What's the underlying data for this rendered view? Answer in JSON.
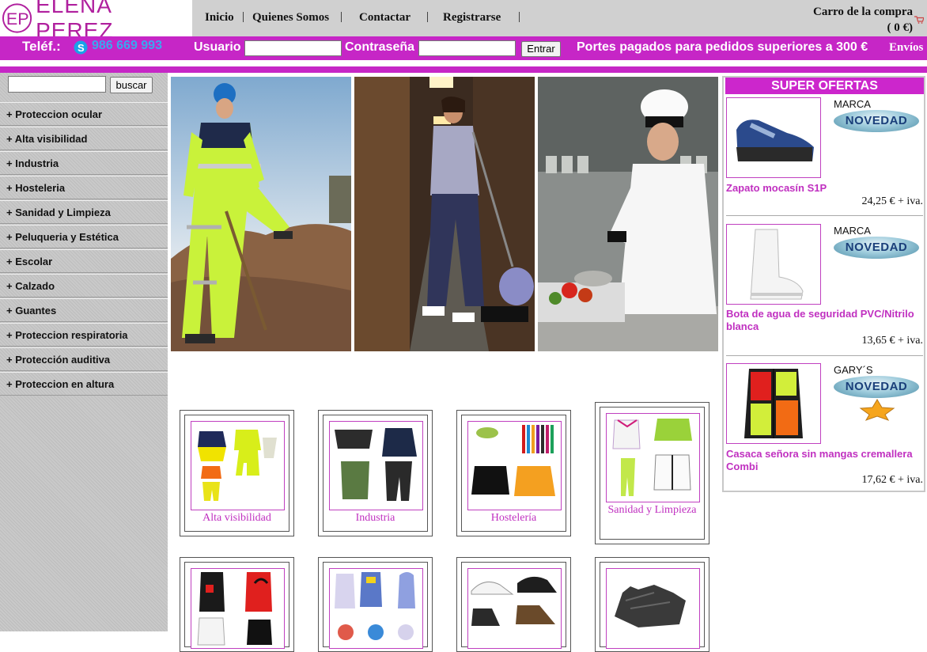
{
  "brand": {
    "name": "ELENA PEREZ",
    "logo_letters": "EP"
  },
  "nav": [
    {
      "label": "Inicio"
    },
    {
      "label": "Quienes Somos"
    },
    {
      "label": "Contactar"
    },
    {
      "label": "Registrarse"
    }
  ],
  "cart": {
    "label": "Carro de la compra",
    "total": "( 0 €)"
  },
  "bar": {
    "phone_label": "Teléf.:",
    "phone_number": "986 669 993",
    "user_label": "Usuario",
    "password_label": "Contraseña",
    "login_button": "Entrar",
    "shipping_notice": "Portes pagados para pedidos superiores a 300 €",
    "shipping_link": "Envíos"
  },
  "search": {
    "button": "buscar",
    "value": ""
  },
  "categories": [
    {
      "label": "+ Proteccion ocular"
    },
    {
      "label": "+ Alta visibilidad"
    },
    {
      "label": "+ Industria"
    },
    {
      "label": "+ Hosteleria"
    },
    {
      "label": "+ Sanidad y Limpieza"
    },
    {
      "label": "+ Peluqueria y Estética"
    },
    {
      "label": "+ Escolar"
    },
    {
      "label": "+ Calzado"
    },
    {
      "label": "+ Guantes"
    },
    {
      "label": "+ Proteccion respiratoria"
    },
    {
      "label": "+ Protección auditiva"
    },
    {
      "label": "+ Proteccion en altura"
    }
  ],
  "tiles": [
    {
      "label": "Alta visibilidad"
    },
    {
      "label": "Industria"
    },
    {
      "label": "Hostelería"
    },
    {
      "label": "Sanidad y Limpieza"
    }
  ],
  "offers": {
    "title": "SUPER OFERTAS",
    "badge": "NOVEDAD",
    "items": [
      {
        "brand": "MARCA",
        "name": "Zapato mocasín S1P",
        "price": "24,25 € + iva."
      },
      {
        "brand": "MARCA",
        "name": "Bota de agua de seguridad PVC/Nitrilo blanca",
        "price": "13,65 € + iva."
      },
      {
        "brand": "GARY´S",
        "name": "Casaca señora sin mangas cremallera Combi",
        "price": "17,62 € + iva."
      }
    ]
  },
  "colors": {
    "accent": "#c626c6",
    "header_bg": "#d0d0d0",
    "sidebar_bg": "#c4c4c4",
    "link": "#c030c0"
  }
}
